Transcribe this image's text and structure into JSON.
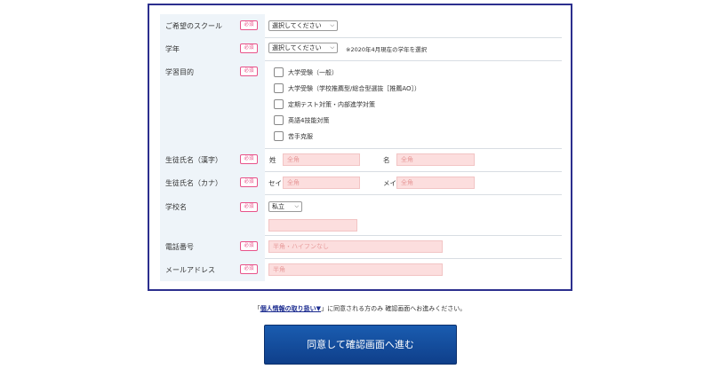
{
  "required_badge": "必須",
  "rows": {
    "school": {
      "label": "ご希望のスクール",
      "select": "選択してください"
    },
    "grade": {
      "label": "学年",
      "select": "選択してください",
      "note": "※2020年4月現在の学年を選択"
    },
    "purpose": {
      "label": "学習目的",
      "options": [
        "大学受験（一般）",
        "大学受験（学校推薦型/総合型選抜［推薦AO］）",
        "定期テスト対策・内部進学対策",
        "英語4技能対策",
        "苦手克服"
      ]
    },
    "name_kanji": {
      "label": "生徒氏名（漢字）",
      "last_prefix": "姓",
      "last_placeholder": "全角",
      "first_prefix": "名",
      "first_placeholder": "全角"
    },
    "name_kana": {
      "label": "生徒氏名（カナ）",
      "last_prefix": "セイ",
      "last_placeholder": "全角",
      "first_prefix": "メイ",
      "first_placeholder": "全角"
    },
    "school_name": {
      "label": "学校名",
      "select": "私立"
    },
    "phone": {
      "label": "電話番号",
      "placeholder": "半角・ハイフンなし"
    },
    "email": {
      "label": "メールアドレス",
      "placeholder": "半角"
    }
  },
  "agree": {
    "open": "「",
    "link": "個人情報の取り扱い▼",
    "close": "」に同意される方のみ 確認画面へお進みください。"
  },
  "submit_label": "同意して確認画面へ進む"
}
